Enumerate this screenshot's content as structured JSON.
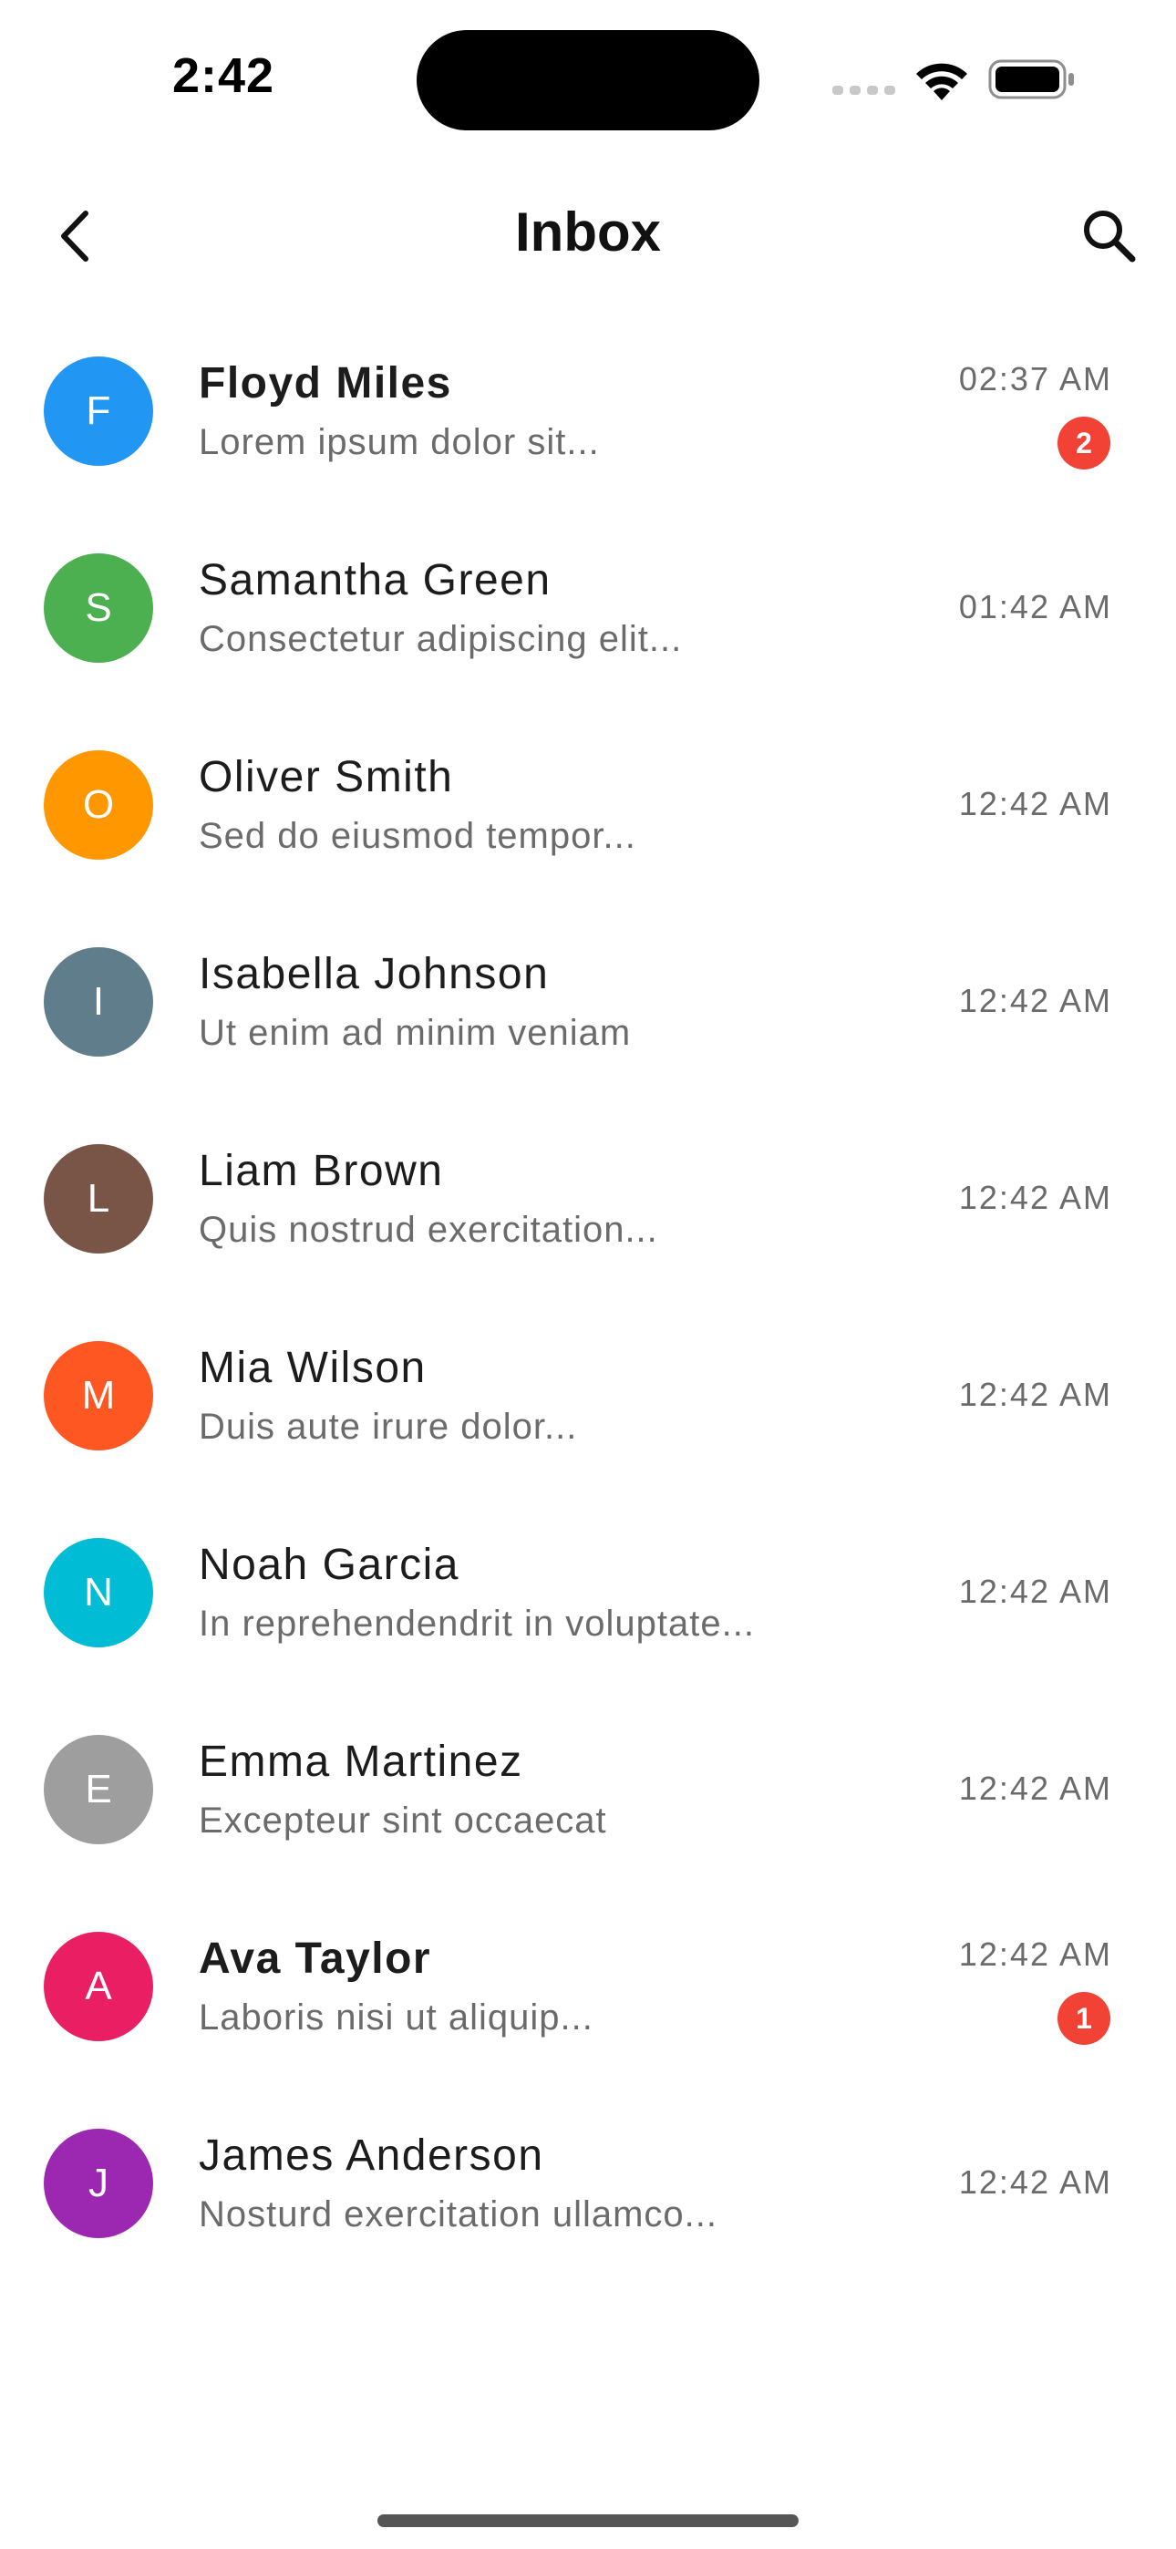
{
  "status_bar": {
    "time": "2:42",
    "icons": [
      "signal-icon",
      "wifi-icon",
      "battery-icon"
    ]
  },
  "header": {
    "title": "Inbox",
    "back_icon": "chevron-left-icon",
    "search_icon": "search-icon"
  },
  "colors": {
    "badge": "#f24236",
    "preview_text": "#6b6b6b"
  },
  "messages": [
    {
      "initial": "F",
      "name": "Floyd Miles",
      "preview": "Lorem ipsum dolor sit...",
      "time": "02:37 AM",
      "unread": true,
      "badge": "2",
      "avatar_color": "#2196F3"
    },
    {
      "initial": "S",
      "name": "Samantha Green",
      "preview": "Consectetur adipiscing elit...",
      "time": "01:42 AM",
      "unread": false,
      "badge": null,
      "avatar_color": "#4CAF50"
    },
    {
      "initial": "O",
      "name": "Oliver Smith",
      "preview": "Sed do eiusmod tempor...",
      "time": "12:42 AM",
      "unread": false,
      "badge": null,
      "avatar_color": "#FF9800"
    },
    {
      "initial": "I",
      "name": "Isabella Johnson",
      "preview": "Ut enim ad minim veniam",
      "time": "12:42 AM",
      "unread": false,
      "badge": null,
      "avatar_color": "#607D8B"
    },
    {
      "initial": "L",
      "name": "Liam Brown",
      "preview": "Quis nostrud exercitation...",
      "time": "12:42 AM",
      "unread": false,
      "badge": null,
      "avatar_color": "#795548"
    },
    {
      "initial": "M",
      "name": "Mia Wilson",
      "preview": "Duis aute irure dolor...",
      "time": "12:42 AM",
      "unread": false,
      "badge": null,
      "avatar_color": "#FF5722"
    },
    {
      "initial": "N",
      "name": "Noah Garcia",
      "preview": "In reprehendendrit in voluptate...",
      "time": "12:42 AM",
      "unread": false,
      "badge": null,
      "avatar_color": "#00BCD4"
    },
    {
      "initial": "E",
      "name": "Emma Martinez",
      "preview": "Excepteur sint occaecat",
      "time": "12:42 AM",
      "unread": false,
      "badge": null,
      "avatar_color": "#9E9E9E"
    },
    {
      "initial": "A",
      "name": "Ava Taylor",
      "preview": "Laboris nisi ut aliquip...",
      "time": "12:42 AM",
      "unread": true,
      "badge": "1",
      "avatar_color": "#E91E63"
    },
    {
      "initial": "J",
      "name": "James Anderson",
      "preview": "Nosturd exercitation ullamco...",
      "time": "12:42 AM",
      "unread": false,
      "badge": null,
      "avatar_color": "#9C27B0"
    }
  ]
}
